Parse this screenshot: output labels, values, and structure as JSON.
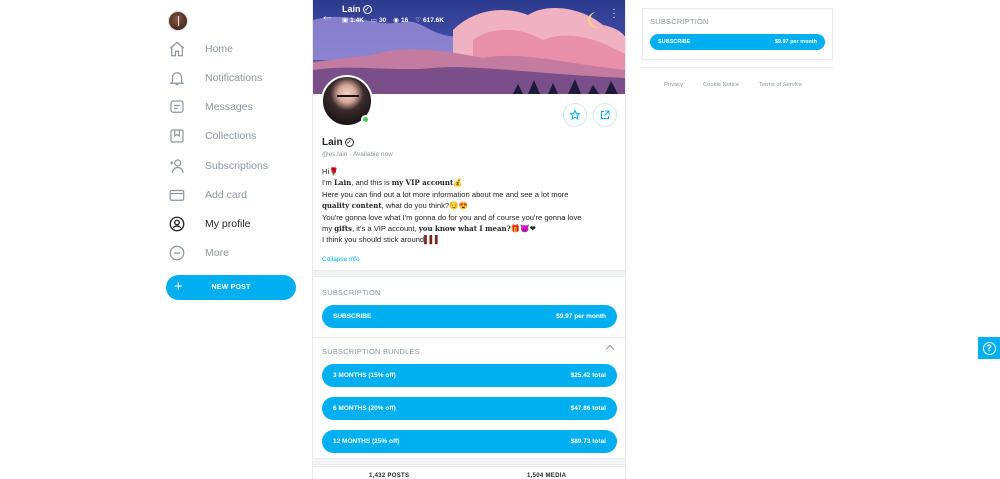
{
  "sidebar": {
    "nav": [
      {
        "label": "Home",
        "icon": "home-icon"
      },
      {
        "label": "Notifications",
        "icon": "bell-icon"
      },
      {
        "label": "Messages",
        "icon": "message-icon"
      },
      {
        "label": "Collections",
        "icon": "bookmark-icon"
      },
      {
        "label": "Subscriptions",
        "icon": "subscriptions-icon"
      },
      {
        "label": "Add card",
        "icon": "card-icon"
      },
      {
        "label": "My profile",
        "icon": "profile-icon",
        "active": true
      },
      {
        "label": "More",
        "icon": "more-icon"
      }
    ],
    "new_post": "NEW POST"
  },
  "profile": {
    "name": "Lain",
    "stats": {
      "photos": "1.4K",
      "videos": "30",
      "streams": "16",
      "likes": "617.6K"
    },
    "handle": "@es.lain",
    "status": "Available now",
    "bio": {
      "l1": "Hi",
      "l2a": "I'm ",
      "l2b": "Lain",
      "l2c": ", and this is ",
      "l2d": "my VIP account",
      "l3": "Here you can find out a lot more information about me and see a lot more",
      "l4a": "quality content",
      "l4b": ", what do you think?",
      "l5": "You're gonna love what I'm gonna do for you and of course you're gonna love",
      "l6a": "my ",
      "l6b": "gifts",
      "l6c": ", it's a VIP account, ",
      "l6d": "you know what I mean?",
      "l7": "I think you should stick around"
    },
    "collapse": "Collapse info"
  },
  "subscription": {
    "title": "SUBSCRIPTION",
    "button_label": "SUBSCRIBE",
    "price": "$9.97 per month"
  },
  "bundles": {
    "title": "SUBSCRIPTION BUNDLES",
    "items": [
      {
        "label": "3 MONTHS (15% off)",
        "price": "$25.42 total"
      },
      {
        "label": "6 MONTHS (20% off)",
        "price": "$47.86 total"
      },
      {
        "label": "12 MONTHS (25% off)",
        "price": "$89.73 total"
      }
    ]
  },
  "tabs": {
    "posts": "1,432 POSTS",
    "media": "1,504 MEDIA"
  },
  "right": {
    "title": "SUBSCRIPTION",
    "button_label": "SUBSCRIBE",
    "price": "$9.97 per month",
    "footer": [
      "Privacy",
      "Cookie Notice",
      "Terms of Service"
    ]
  },
  "colors": {
    "accent": "#00aff0",
    "muted": "#8a96a3",
    "text": "#242529"
  }
}
